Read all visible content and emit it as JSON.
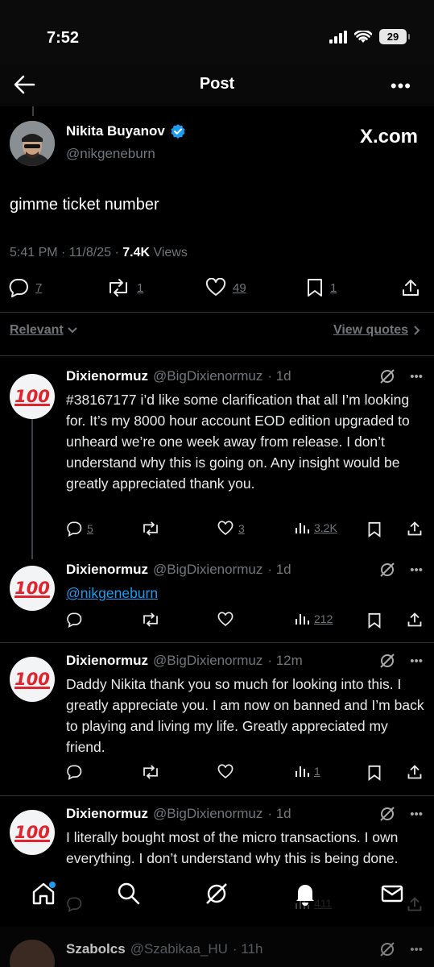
{
  "status_bar": {
    "time": "7:52",
    "battery": "29"
  },
  "header": {
    "title": "Post"
  },
  "post": {
    "author_name": "Nikita Buyanov",
    "author_handle": "@nikgeneburn",
    "brand": "X.com",
    "text": "gimme ticket number",
    "time": "5:41 PM · 11/8/25 · ",
    "views_count": "7.4K",
    "views_label": " Views",
    "replies": "7",
    "reposts": "1",
    "likes": "49",
    "bookmarks": "1"
  },
  "sort": {
    "left_label": "Relevant",
    "right_label": "View quotes"
  },
  "replies": [
    {
      "name": "Dixienormuz",
      "handle": "@BigDixienormuz",
      "time": "· 1d",
      "avatar_text": "100",
      "text": "#38167177  i’d like some clarification that all I’m looking for. It’s my 8000 hour account EOD edition upgraded to unheard  we’re one week away from release. I don’t understand why this is going on. Any insight would be greatly appreciated thank you.",
      "replies": "5",
      "reposts": "",
      "likes": "3",
      "views": "3.2K"
    },
    {
      "name": "Dixienormuz",
      "handle": "@BigDixienormuz",
      "time": "· 1d",
      "avatar_text": "100",
      "link": "@nikgeneburn",
      "replies": "",
      "reposts": "",
      "likes": "",
      "views": "212"
    },
    {
      "name": "Dixienormuz",
      "handle": "@BigDixienormuz",
      "time": "· 12m",
      "avatar_text": "100",
      "text": "Daddy Nikita thank you so much for looking into this. I greatly appreciate you. I am now on banned and I’m back to playing and living my life. Greatly appreciated my friend.",
      "replies": "",
      "reposts": "",
      "likes": "",
      "views": "1"
    },
    {
      "name": "Dixienormuz",
      "handle": "@BigDixienormuz",
      "time": "· 1d",
      "avatar_text": "100",
      "text": "I literally bought most of the micro transactions. I own everything. I don’t understand why this is being done.",
      "views": "411"
    },
    {
      "name": "Szabolcs",
      "handle": "@Szabikaa_HU",
      "time": "· 11h"
    }
  ],
  "colors": {
    "background": "#000000",
    "text": "#e7e9ea",
    "muted": "#71767b",
    "link": "#1d9bf0",
    "verified": "#1d9bf0",
    "avatar_emoji": "#e0242d"
  },
  "icons": [
    "back-arrow-icon",
    "more-icon",
    "verified-badge-icon",
    "reply-icon",
    "repost-icon",
    "like-icon",
    "bookmark-icon",
    "share-icon",
    "views-icon",
    "grok-icon",
    "home-icon",
    "search-icon",
    "notifications-icon",
    "messages-icon"
  ]
}
